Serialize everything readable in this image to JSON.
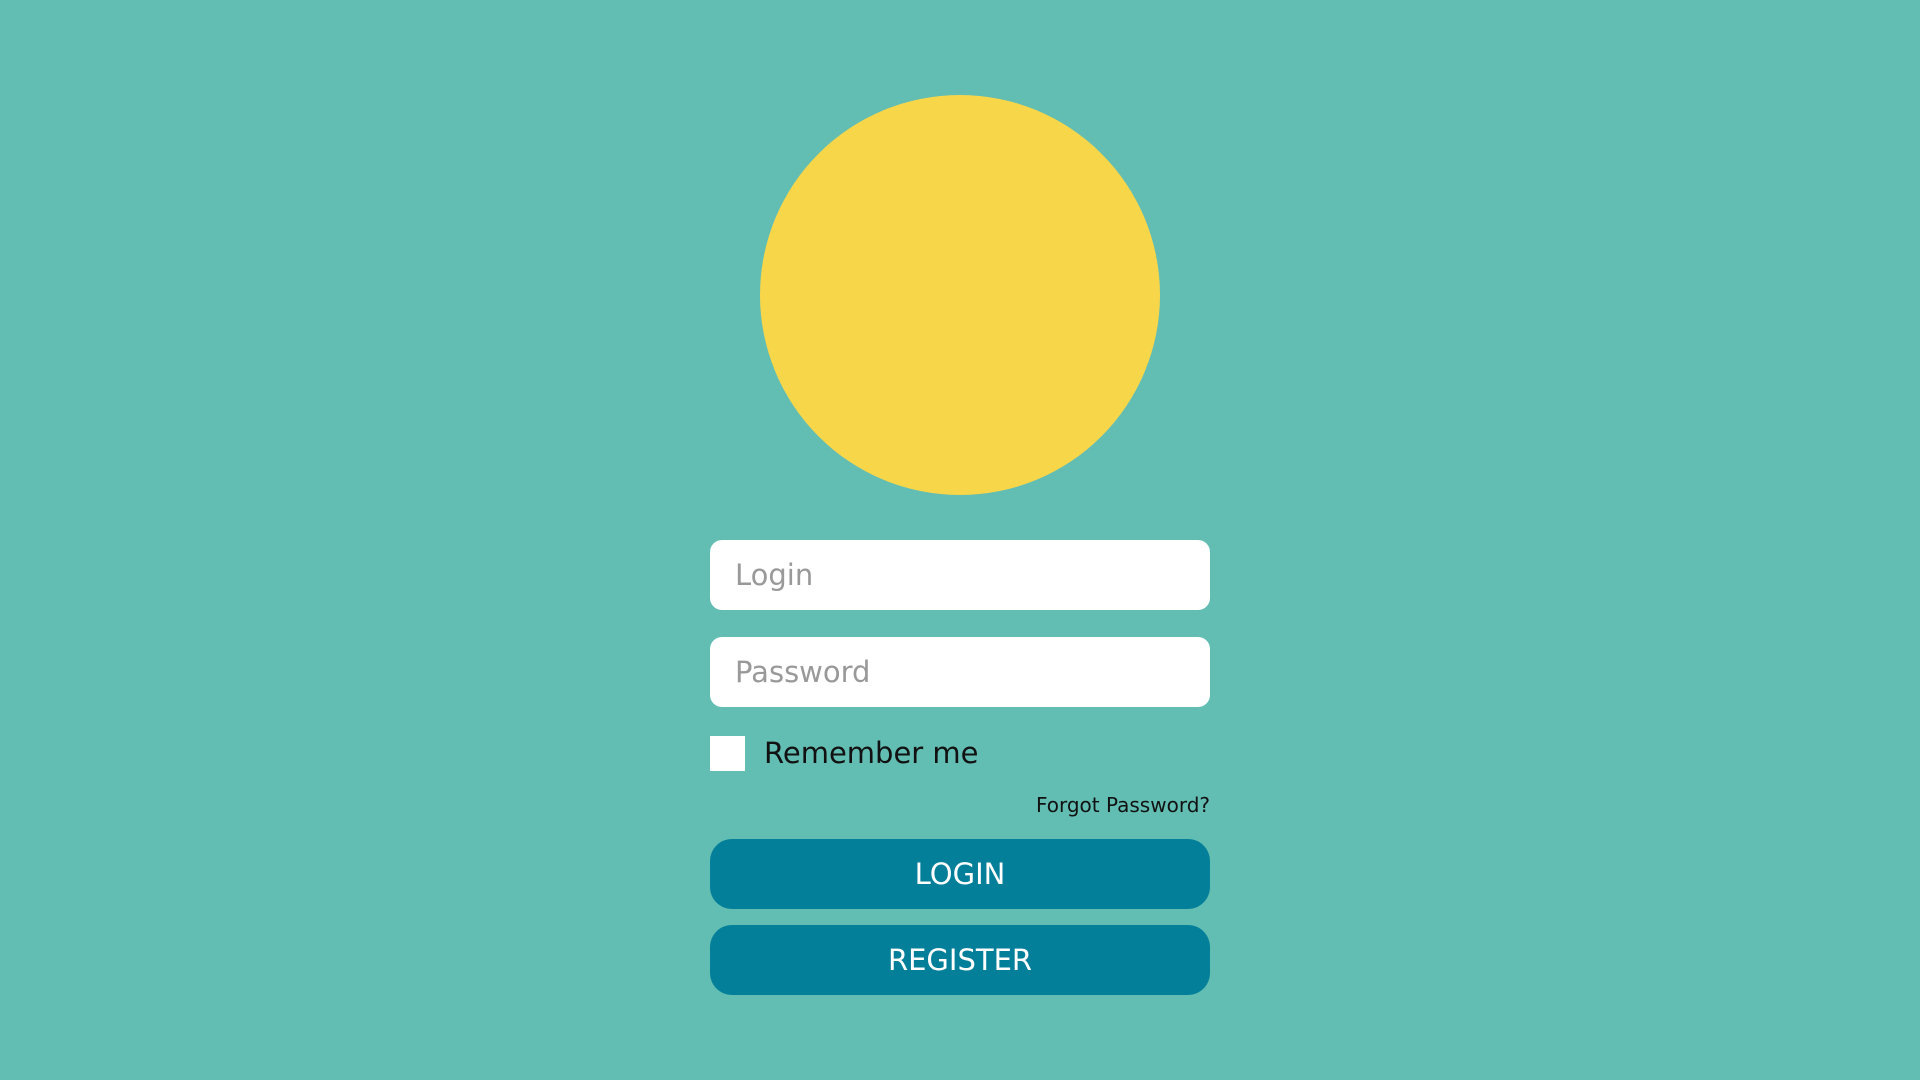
{
  "colors": {
    "background": "#62bdb3",
    "logo": "#f8d64a",
    "button": "#037f9a",
    "input": "#ffffff"
  },
  "logo": {
    "shape": "circle"
  },
  "form": {
    "login_placeholder": "Login",
    "password_placeholder": "Password",
    "remember_label": "Remember me",
    "remember_checked": false,
    "forgot_label": "Forgot Password?",
    "login_button": "LOGIN",
    "register_button": "REGISTER"
  }
}
